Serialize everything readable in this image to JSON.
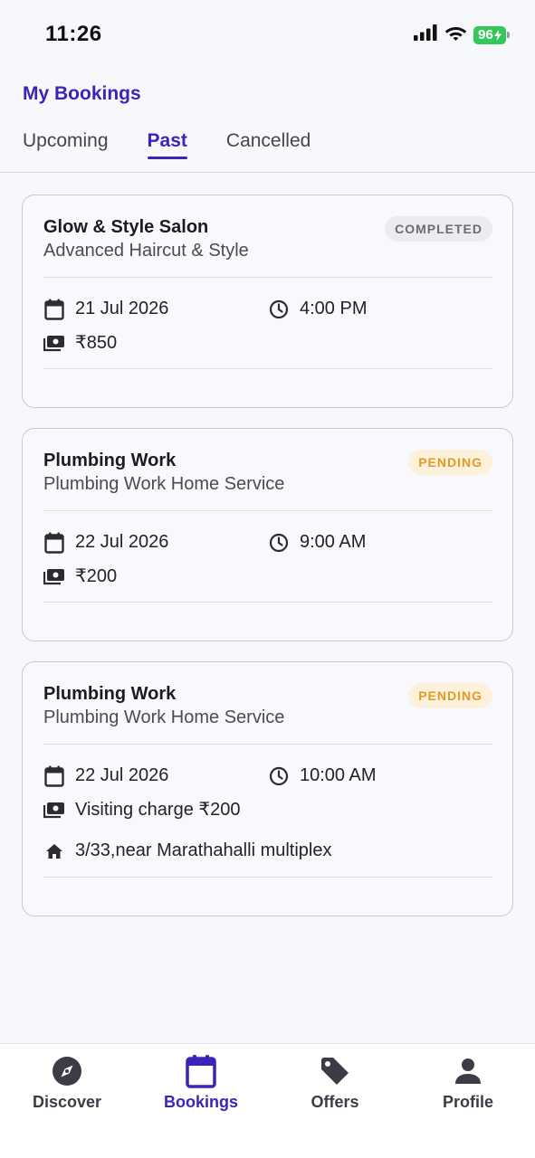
{
  "status_bar": {
    "time": "11:26",
    "battery": "96"
  },
  "header": {
    "title": "My Bookings"
  },
  "tabs": [
    {
      "label": "Upcoming",
      "active": false
    },
    {
      "label": "Past",
      "active": true
    },
    {
      "label": "Cancelled",
      "active": false
    }
  ],
  "bookings": [
    {
      "title": "Glow & Style Salon",
      "service": "Advanced Haircut & Style",
      "status": "COMPLETED",
      "date": "21 Jul 2026",
      "time": "4:00 PM",
      "price": "₹850"
    },
    {
      "title": "Plumbing Work",
      "service": "Plumbing Work Home Service",
      "status": "PENDING",
      "date": "22 Jul 2026",
      "time": "9:00 AM",
      "price": "₹200"
    },
    {
      "title": "Plumbing Work",
      "service": "Plumbing Work Home Service",
      "status": "PENDING",
      "date": "22 Jul 2026",
      "time": "10:00 AM",
      "price": "Visiting charge ₹200",
      "address": "3/33,near Marathahalli multiplex"
    }
  ],
  "bottom_nav": [
    {
      "label": "Discover",
      "icon": "compass-icon",
      "active": false
    },
    {
      "label": "Bookings",
      "icon": "calendar-icon",
      "active": true
    },
    {
      "label": "Offers",
      "icon": "tag-icon",
      "active": false
    },
    {
      "label": "Profile",
      "icon": "person-icon",
      "active": false
    }
  ],
  "colors": {
    "accent": "#3a25b8",
    "completed_badge_bg": "#ececf0",
    "pending_badge_bg": "#fdf1dc",
    "pending_text": "#e39a22",
    "battery": "#34c759"
  }
}
